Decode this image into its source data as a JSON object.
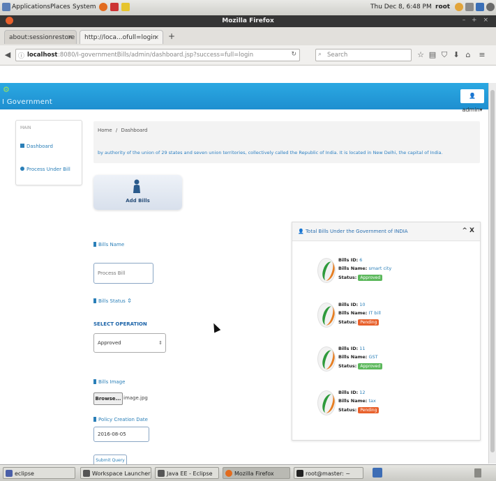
{
  "colors": {
    "header_blue": "#2ba8e2",
    "link_blue": "#2a7fb8",
    "approved_green": "#5cb85c",
    "pending_orange": "#e8612c"
  },
  "top_panel": {
    "menus": [
      "Applications",
      "Places",
      "System"
    ],
    "clock": "Thu Dec 8, 6:48 PM",
    "user": "root"
  },
  "window": {
    "title": "Mozilla Firefox"
  },
  "tabs": [
    {
      "label": "about:sessionrestore"
    },
    {
      "label": "http://loca...ofull=login"
    }
  ],
  "navbar": {
    "url_host": "localhost",
    "url_path": ":8080/I-governmentBills/admin/dashboard.jsp?success=full=login",
    "search_placeholder": "Search"
  },
  "app": {
    "brand": "I Government",
    "admin_label": "admin"
  },
  "sidebar": {
    "heading": "MAIN",
    "items": [
      {
        "label": "Dashboard",
        "icon": "dashboard-icon"
      },
      {
        "label": "Process Under Bill"
      }
    ]
  },
  "breadcrumb": {
    "home": "Home",
    "current": "Dashboard"
  },
  "description": "by authority of the union of 29 states and seven union territories, collectively called the Republic of India. It is located in New Delhi, the capital of India.",
  "add_card": {
    "label": "Add Bills"
  },
  "form": {
    "bill_name_label": "Bills Name",
    "bill_name_placeholder": "Process Bill",
    "bill_status_label": "Bills Status",
    "select_label": "SELECT OPERATION",
    "select_value": "Approved",
    "bill_image_label": "Bills Image",
    "browse_label": "Browse...",
    "file_name": "image.jpg",
    "date_label": "Policy Creation Date",
    "date_value": "2016-08-05",
    "submit_label": "Submit Query"
  },
  "bills_panel": {
    "title": "Total Bills Under the Government of INDIA",
    "controls": "^ X",
    "id_label": "Bills ID:",
    "name_label": "Bills Name:",
    "status_label": "Status:",
    "bills": [
      {
        "id": "6",
        "name": "smart city",
        "status": "Approved"
      },
      {
        "id": "10",
        "name": "IT bill",
        "status": "Pending"
      },
      {
        "id": "11",
        "name": "GST",
        "status": "Approved"
      },
      {
        "id": "12",
        "name": "tax",
        "status": "Pending"
      }
    ]
  },
  "taskbar": {
    "items": [
      {
        "label": "eclipse"
      },
      {
        "label": "Workspace Launcher"
      },
      {
        "label": "Java EE - Eclipse"
      },
      {
        "label": "Mozilla Firefox"
      },
      {
        "label": "root@master: ~"
      }
    ]
  }
}
